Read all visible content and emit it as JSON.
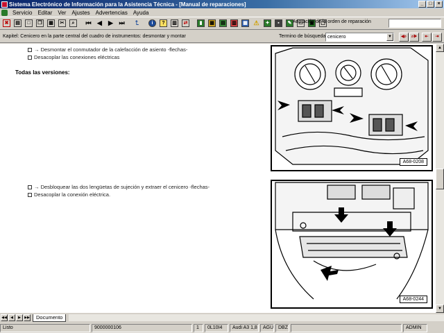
{
  "window": {
    "title": "Sistema Electrónico de Información para la Asistencia Técnica - [Manual de reparaciones]",
    "buttons": [
      "_",
      "□",
      "×"
    ]
  },
  "menu": {
    "items": [
      "Servicio",
      "Editar",
      "Ver",
      "Ajustes",
      "Advertencias",
      "Ayuda"
    ]
  },
  "toolbar": {
    "order_label": "Anotación de la orden de reparación",
    "order_value": ""
  },
  "kapitel": {
    "text": "Kapitel: Cenicero en la parte central del cuadro de instrumentos: desmontar y montar",
    "search_label": "Termino de búsqueda:",
    "search_value": "cenicero"
  },
  "document": {
    "lines_top": [
      "→ Desmontar el conmutador de la calefacción de asiento -flechas-",
      "Desacoplar las conexiones eléctricas"
    ],
    "heading": "Todas las versiones:",
    "lines_bottom": [
      "→ Desbloquear las dos lengüetas de sujeción y extraer el cenicero -flechas-",
      "Desacoplar la conexión eléctrica."
    ],
    "figure_1_label": "A68-0208",
    "figure_2_label": "A68-0244"
  },
  "tabs": {
    "active": "Documento"
  },
  "status": {
    "state": "Listo",
    "number": "9000000106",
    "page": "1",
    "code": "0L10I4",
    "model": "Audi A3 1,8",
    "engine": "AGU",
    "gear": "DBZ",
    "user": "ADMIN"
  }
}
